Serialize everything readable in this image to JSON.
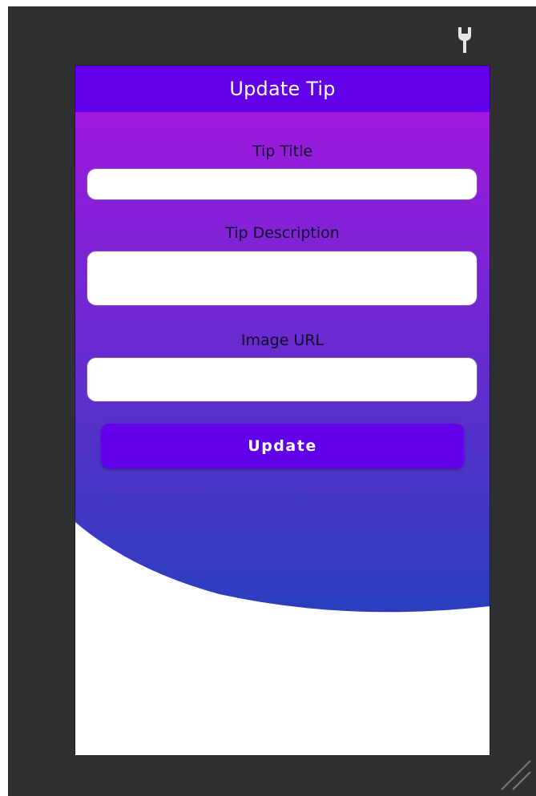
{
  "app_bar": {
    "title": "Update Tip",
    "color": "#6200ea"
  },
  "form": {
    "tip_title": {
      "label": "Tip Title",
      "value": "",
      "placeholder": ""
    },
    "tip_description": {
      "label": "Tip Description",
      "value": "",
      "placeholder": ""
    },
    "image_url": {
      "label": "Image URL",
      "value": "",
      "placeholder": ""
    },
    "update_button": {
      "label": "Update"
    }
  },
  "theme": {
    "gradient_top": "#a915e0",
    "gradient_bottom": "#2a3fbd",
    "editor_background": "#2f3032"
  },
  "editor": {
    "tool_icon": "wrench-icon",
    "resize_icon": "resize-handle-icon"
  }
}
